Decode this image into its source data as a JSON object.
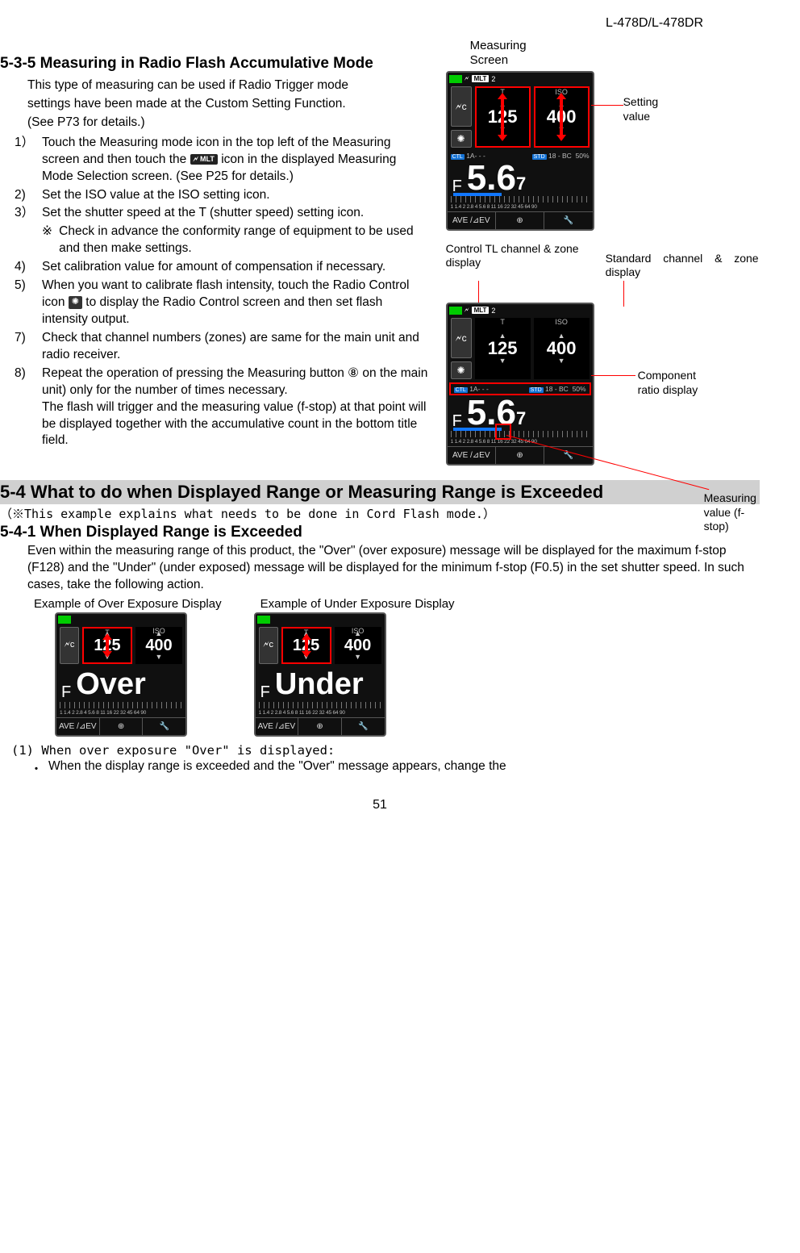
{
  "header": {
    "model": "L-478D/L-478DR"
  },
  "page_number": "51",
  "section_535": {
    "title": "5-3-5 Measuring in Radio Flash Accumulative Mode",
    "intro": [
      "This type of measuring can be used if Radio Trigger mode",
      "settings have been made at the Custom Setting Function.",
      "(See P73 for details.)"
    ],
    "steps": [
      {
        "num": "1）",
        "pre": "Touch the Measuring mode icon in the top left of the Measuring screen and then touch the ",
        "icon": "🗲 MLT",
        "post": " icon in the displayed Measuring Mode Selection screen. (See P25 for details.)"
      },
      {
        "num": "2)",
        "text": "Set the ISO value at the ISO setting icon."
      },
      {
        "num": "3）",
        "text": "Set the shutter speed at the T (shutter speed) setting icon.",
        "note_symbol": "※",
        "note_text": "Check in advance the conformity range of equipment to be used and then make settings."
      },
      {
        "num": "4)",
        "text": "Set calibration value for amount of compensation if necessary."
      },
      {
        "num": "5)",
        "pre": "When you want to calibrate flash intensity, touch the Radio Control icon ",
        "icon": "✺",
        "post": " to display the Radio Control screen and then set flash intensity output."
      },
      {
        "num": "7)",
        "text": "Check that channel numbers (zones) are same for the main unit and radio receiver."
      },
      {
        "num": "8)",
        "pre": "Repeat the operation of pressing the Measuring button ",
        "circle": "⑧",
        "post": " on the main unit) only for the number of times necessary.",
        "extra": "The flash will trigger and the measuring value (f-stop) at that point will be displayed together with the accumulative count in the bottom title field."
      }
    ]
  },
  "screen_labels": {
    "measuring_screen": "Measuring\nScreen",
    "setting_value": "Setting\nvalue",
    "ctrl_channel": "Control TL channel & zone display",
    "std_channel": "Standard channel & zone display",
    "component_ratio": "Component\nratio display",
    "measuring_value": "Measuring\nvalue (f-stop)"
  },
  "screen_common": {
    "mlt_tag": "MLT",
    "mlt_count": "2",
    "t_label": "T",
    "iso_label": "ISO",
    "t_value": "125",
    "iso_value": "400",
    "ctl": "CTL",
    "ctl_text": "1A- - -",
    "std": "STD",
    "std_text": "18 - BC",
    "percent": "50%",
    "F": "F",
    "f_main": "5.6",
    "f_sub": "7",
    "ruler_nums": "1 1.4 2 2.8 4 5.6 8 11 16 22 32 45 64 90",
    "btm_ave": "AVE /⊿EV",
    "btm_mid": "⊕",
    "btm_right": "🔧",
    "radio_icon": "✺",
    "mode_icon": "🗲c"
  },
  "section_54": {
    "title": "5-4 What to do when Displayed Range or Measuring Range is Exceeded",
    "note": "（※This example explains what needs to be done in Cord Flash mode.）"
  },
  "section_541": {
    "title": "5-4-1 When Displayed Range is Exceeded",
    "body": "Even within the measuring range of this product, the \"Over\" (over exposure) message will be displayed for the maximum f-stop (F128) and the \"Under\" (under exposed) message will be displayed for the minimum f-stop (F0.5) in the set shutter speed. In such cases, take the following action.",
    "example_over_title": "Example of Over Exposure Display",
    "example_under_title": "Example of Under Exposure Display",
    "over_text": "Over",
    "under_text": "Under",
    "subhead": "(1) When over exposure \"Over\" is displayed:",
    "bullet_sym": "・",
    "bullet_text": "When the display range is exceeded and the \"Over\" message appears, change the"
  }
}
